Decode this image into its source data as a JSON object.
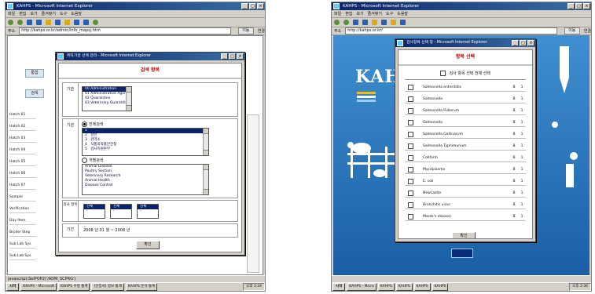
{
  "left_window": {
    "title": "KAHPS - Microsoft Internet Explorer",
    "menu": [
      "파일",
      "편집",
      "보기",
      "즐겨찾기",
      "도구",
      "도움말"
    ],
    "address": "http://kahps.or.kr/admin/info_mapsj.htm",
    "go_label": "이동",
    "links_label": "연결",
    "status_text": "javascript:SelPOP2('/ADM_SCPRG')",
    "taskbar": {
      "start": "시작",
      "tasks": [
        "KAHPS - Microsoft",
        "KAHPS 수정 통계",
        "(인증서) 정보 통계",
        "KAHPS 분석 통계"
      ],
      "clock": "오후 3:34"
    },
    "background_page": {
      "tabs": [
        "통합",
        "검색"
      ],
      "rows": [
        "Hatch 01",
        "Hatch 02",
        "Hatch 03",
        "Hatch 04",
        "Hatch 05",
        "Hatch 06",
        "Hatch 07",
        "Sample",
        "Verification",
        "Day Item",
        "Broiler Step",
        "Sub Lab Sys",
        "Sub Lab Sys"
      ]
    },
    "dialog": {
      "title": "위탁기관 선택 관리 - Microsoft Internet Explorer",
      "heading": "검색 항목",
      "sec1_label": "기관",
      "sec1_items": [
        "00 Administration",
        "01 Administrative Agency",
        "02 Quarantine",
        "03 Veterinary Quarantine"
      ],
      "sec2_label": "기관",
      "radio1": "전체검색",
      "sec2_top_items": [
        "1",
        "2",
        "3",
        "4",
        "5"
      ],
      "sec2_top_sel_item": "1",
      "sec2_top_item_names": [
        "일반",
        "검역소",
        "식품의약품안전청",
        "검사지원본부"
      ],
      "radio2": "개별검색",
      "sec2_bottom_items": [
        "Animal Disease",
        "Poultry Section",
        "Veterinary Research",
        "Animal Health",
        "Disease Control"
      ],
      "sec3_label": "검사 항목",
      "sec3_boxes": [
        "전체",
        "전체",
        "전체"
      ],
      "sec4_label": "기간",
      "date_value": "2008 년 01 월 ~ 2008 년",
      "confirm_button": "확인"
    }
  },
  "right_window": {
    "title": "KAHPS - Microsoft Internet Explorer",
    "menu": [
      "파일",
      "편집",
      "보기",
      "즐겨찾기",
      "도구",
      "도움말"
    ],
    "address": "http://kahps.or.kr/",
    "go_label": "이동",
    "links_label": "연결",
    "logo_text": "KAH",
    "dialog": {
      "title": "검사항목 선택 창 - Microsoft Internet Explorer",
      "heading": "항목 선택",
      "select_all_label": "검사 항목 선택 전체 선택",
      "rows": [
        {
          "name": "Salmonella enteritidis",
          "c1": "B",
          "c2": "1"
        },
        {
          "name": "Salmonella",
          "c1": "B",
          "c2": "1"
        },
        {
          "name": "Salmonella Pullorum",
          "c1": "B",
          "c2": "1"
        },
        {
          "name": "Salmonella",
          "c1": "B",
          "c2": "1"
        },
        {
          "name": "Salmonella Gallinarum",
          "c1": "B",
          "c2": "1"
        },
        {
          "name": "Salmonella Typhimurium",
          "c1": "B",
          "c2": "1"
        },
        {
          "name": "Coliform",
          "c1": "B",
          "c2": "1"
        },
        {
          "name": "Mycoplasma",
          "c1": "B",
          "c2": "1"
        },
        {
          "name": "E. coli",
          "c1": "B",
          "c2": "1"
        },
        {
          "name": "Newcastle",
          "c1": "B",
          "c2": "1"
        },
        {
          "name": "Bronchitis virus",
          "c1": "B",
          "c2": "1"
        },
        {
          "name": "Marek's disease",
          "c1": "B",
          "c2": "1"
        }
      ],
      "confirm_button": "확인"
    },
    "status_text": "",
    "taskbar": {
      "start": "시작",
      "tasks": [
        "KAHPS - Micro",
        "KAHPS",
        "KAHPS",
        "KAHPS",
        "KAHPS"
      ],
      "clock": "오후 3:36"
    }
  }
}
